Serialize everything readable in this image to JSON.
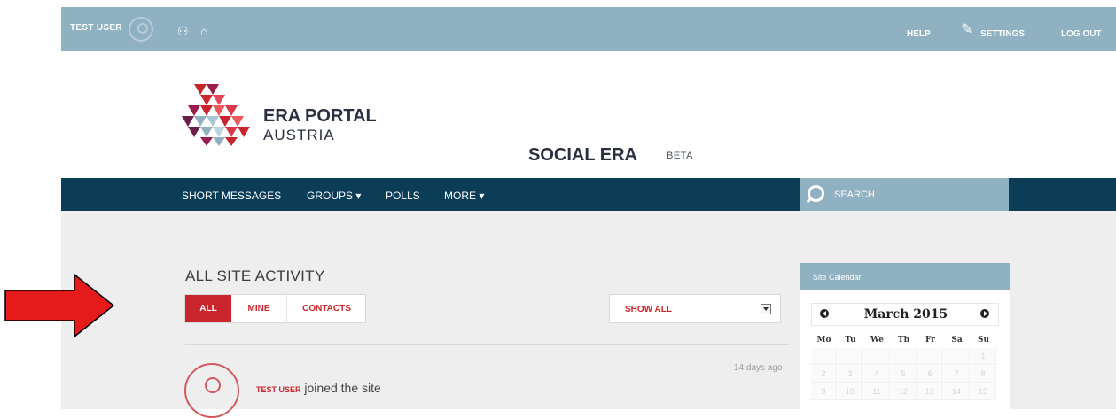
{
  "topbar": {
    "user_name": "TEST USER",
    "icons": [
      "avatar-icon",
      "contacts-icon",
      "notifications-icon",
      "wrench-icon"
    ],
    "help_label": "HELP",
    "settings_label": "SETTINGS",
    "logout_label": "LOG OUT"
  },
  "brand": {
    "line1": "ERA PORTAL",
    "line2": "AUSTRIA",
    "product": "SOCIAL ERA",
    "badge": "BETA"
  },
  "nav": {
    "items": [
      "SHORT MESSAGES",
      "GROUPS ▾",
      "POLLS",
      "MORE ▾"
    ],
    "search_placeholder": "SEARCH"
  },
  "activity": {
    "title": "ALL SITE ACTIVITY",
    "filters": [
      "ALL",
      "MINE",
      "CONTACTS"
    ],
    "active_filter": "ALL",
    "dropdown_value": "SHOW ALL",
    "items": [
      {
        "user": "TEST USER",
        "text": " joined the site",
        "time": "14 days ago"
      }
    ]
  },
  "calendar": {
    "header": "Site Calendar",
    "month": "March 2015",
    "weekdays": [
      "Mo",
      "Tu",
      "We",
      "Th",
      "Fr",
      "Sa",
      "Su"
    ],
    "rows": [
      [
        "",
        "",
        "",
        "",
        "",
        "",
        "1"
      ],
      [
        "2",
        "3",
        "4",
        "5",
        "6",
        "7",
        "8"
      ],
      [
        "9",
        "10",
        "11",
        "12",
        "13",
        "14",
        "15"
      ]
    ]
  },
  "colors": {
    "topbar": "#8fb1c1",
    "navbar": "#0c3d57",
    "accent_red": "#c8262c",
    "arrow_red": "#e51b1b"
  }
}
